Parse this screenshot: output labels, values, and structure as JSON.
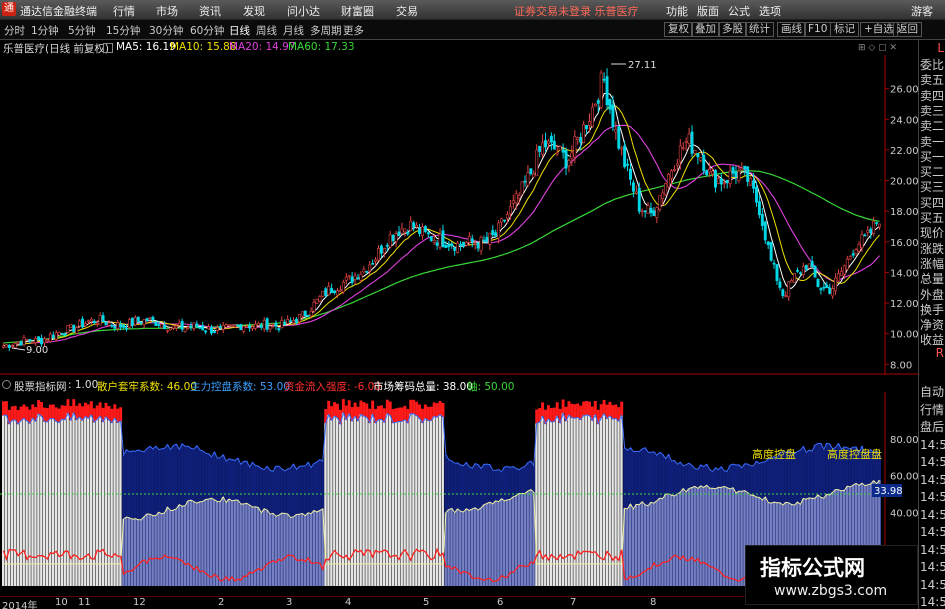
{
  "app": {
    "title": "通达信金融终端",
    "menus": [
      "行情",
      "市场",
      "资讯",
      "发现",
      "问小达",
      "财富圈",
      "交易"
    ],
    "notice": "证券交易未登录",
    "stock_label": "乐普医疗",
    "right_menus": [
      "功能",
      "版面",
      "公式",
      "选项"
    ],
    "guest": "游客"
  },
  "toolbar": {
    "periods": [
      "分时",
      "1分钟",
      "5分钟",
      "15分钟",
      "30分钟",
      "60分钟",
      "日线",
      "周线",
      "月线",
      "多周期",
      "更多"
    ],
    "active": "日线",
    "right_buttons": [
      "复权",
      "叠加",
      "多股",
      "统计",
      "画线",
      "F10",
      "标记",
      "+自选",
      "返回"
    ]
  },
  "chart_header": {
    "name": "乐普医疗(日线 前复权)",
    "ma5": "MA5: 16.19",
    "ma10": "MA10: 15.88",
    "ma20": "MA20: 14.97",
    "ma60": "MA60: 17.33"
  },
  "sidebar": {
    "top": "L",
    "top2": "R",
    "items_main": [
      "委比",
      "卖五",
      "卖四",
      "卖三",
      "卖二",
      "卖一",
      "买一",
      "买二",
      "买三",
      "买四",
      "买五",
      "现价",
      "涨跌",
      "涨幅",
      "总量",
      "外盘",
      "换手",
      "净资",
      "收益"
    ],
    "items_sub": [
      "自动",
      "行情",
      "盘后",
      "14:5",
      "14:5",
      "14:5",
      "14:5",
      "14:5",
      "14:5",
      "14:5",
      "14:5",
      "14:5",
      "14:5"
    ]
  },
  "sub_legend": {
    "name": "股票指标网",
    "v1": ": 1.00",
    "v2": "散户套牢系数: 46.00",
    "v3": "主力控盘系数: 53.00",
    "v4": "资金流入强度: -6.00",
    "v5": "市场筹码总量: 38.00",
    "v6": "轴: 50.00"
  },
  "annotations": {
    "peak": "27.11",
    "low": "9.00",
    "ctrl1": "高度控盘",
    "ctrl2": "高度控盘盘",
    "last": "33.98"
  },
  "watermark": {
    "line1": "指标公式网",
    "line2": "www.zbgs3.com"
  },
  "colors": {
    "up": "#e24444",
    "down": "#00d8e8",
    "ma5": "#ffffff",
    "ma10": "#f0e000",
    "ma20": "#e040e0",
    "ma60": "#38d838",
    "axis_red": "#aa0000"
  },
  "chart_data": [
    {
      "type": "candlestick",
      "title": "乐普医疗(日线 前复权)",
      "y_ticks": [
        8.0,
        10.0,
        12.0,
        14.0,
        16.0,
        18.0,
        20.0,
        22.0,
        24.0,
        26.0
      ],
      "ylim": [
        7.3,
        28.2
      ],
      "x_ticks": [
        "2014年",
        "10",
        "11",
        "12",
        "2",
        "3",
        "4",
        "5",
        "6",
        "7",
        "8"
      ],
      "close": [
        9.2,
        9.4,
        9.6,
        9.5,
        9.9,
        10.2,
        10.4,
        10.8,
        10.9,
        10.6,
        10.5,
        10.8,
        10.9,
        10.7,
        10.4,
        10.4,
        10.5,
        10.3,
        10.2,
        10.4,
        10.6,
        10.5,
        10.6,
        10.5,
        10.8,
        11.2,
        12.0,
        12.8,
        13.2,
        13.6,
        14.2,
        15.0,
        16.2,
        16.8,
        17.1,
        16.5,
        16.2,
        16.0,
        15.8,
        16.0,
        15.9,
        16.4,
        17.8,
        19.0,
        20.6,
        22.4,
        22.0,
        21.3,
        22.8,
        24.6,
        26.7,
        23.2,
        20.5,
        18.3,
        17.8,
        19.6,
        21.5,
        22.6,
        21.8,
        20.2,
        20.0,
        20.6,
        20.1,
        18.2,
        14.6,
        12.5,
        13.8,
        14.6,
        13.0,
        12.9,
        14.3,
        15.8,
        16.3,
        17.6
      ],
      "ma5_last": 16.19,
      "ma10_last": 15.88,
      "ma20_last": 14.97,
      "ma60_last": 17.33,
      "ma60": [
        9.4,
        9.45,
        9.5,
        9.6,
        9.7,
        9.85,
        10.0,
        10.1,
        10.2,
        10.25,
        10.3,
        10.32,
        10.35,
        10.35,
        10.35,
        10.38,
        10.4,
        10.42,
        10.45,
        10.5,
        10.55,
        10.6,
        10.65,
        10.7,
        10.8,
        10.95,
        11.15,
        11.4,
        11.7,
        12.0,
        12.35,
        12.7,
        13.05,
        13.4,
        13.7,
        13.95,
        14.15,
        14.35,
        14.5,
        14.65,
        14.8,
        15.0,
        15.25,
        15.55,
        15.9,
        16.35,
        16.8,
        17.2,
        17.6,
        18.0,
        18.45,
        18.8,
        19.05,
        19.25,
        19.45,
        19.65,
        19.85,
        20.05,
        20.2,
        20.35,
        20.5,
        20.6,
        20.65,
        20.6,
        20.4,
        20.1,
        19.75,
        19.35,
        18.95,
        18.5,
        18.1,
        17.75,
        17.5,
        17.33
      ]
    },
    {
      "type": "bar",
      "title": "股票指标网",
      "y_ticks": [
        20.0,
        40.0,
        60.0,
        80.0
      ],
      "ylim": [
        0,
        100
      ],
      "series": [
        {
          "name": "散户套牢系数",
          "last": 46.0
        },
        {
          "name": "主力控盘系数",
          "last": 53.0
        },
        {
          "name": "资金流入强度",
          "last": -6.0
        },
        {
          "name": "市场筹码总量",
          "last": 38.0
        },
        {
          "name": "轴",
          "last": 50.0
        }
      ]
    }
  ]
}
